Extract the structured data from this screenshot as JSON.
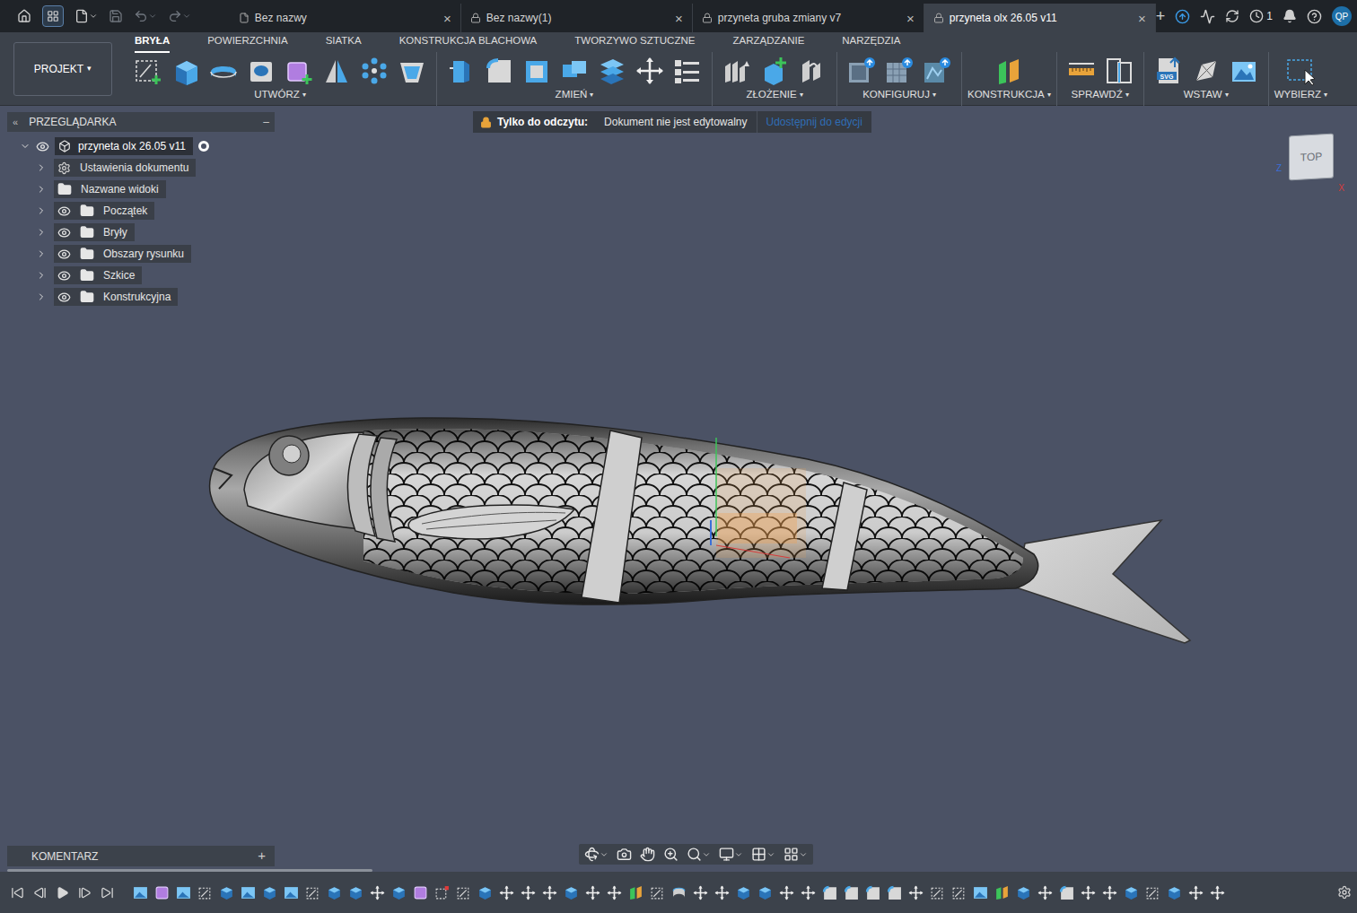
{
  "app_bar": {
    "user_initials": "QP",
    "jobs_count": "1",
    "new_tab": "+",
    "close_glyph": "×"
  },
  "document_tabs": [
    {
      "label": "Bez nazwy",
      "selected": false,
      "locked": false
    },
    {
      "label": "Bez nazwy(1)",
      "selected": false,
      "locked": true
    },
    {
      "label": "przyneta gruba zmiany v7",
      "selected": false,
      "locked": true
    },
    {
      "label": "przyneta olx 26.05 v11",
      "selected": true,
      "locked": true
    }
  ],
  "workspace": {
    "label": "PROJEKT",
    "caret": "▾"
  },
  "ribbon_tabs": [
    {
      "label": "BRYŁA",
      "selected": true
    },
    {
      "label": "POWIERZCHNIA",
      "selected": false
    },
    {
      "label": "SIATKA",
      "selected": false
    },
    {
      "label": "KONSTRUKCJA BLACHOWA",
      "selected": false
    },
    {
      "label": "TWORZYWO SZTUCZNE",
      "selected": false
    },
    {
      "label": "ZARZĄDZANIE",
      "selected": false
    },
    {
      "label": "NARZĘDZIA",
      "selected": false
    }
  ],
  "tool_groups": [
    {
      "label": "UTWÓRZ",
      "caret": "▾",
      "tools": [
        {
          "kind": "sketch",
          "badge": ""
        },
        {
          "kind": "extrude",
          "badge": ""
        },
        {
          "kind": "revolve",
          "badge": ""
        },
        {
          "kind": "hole",
          "badge": ""
        },
        {
          "kind": "form",
          "badge": ""
        },
        {
          "kind": "mirror",
          "badge": ""
        },
        {
          "kind": "pattern",
          "badge": ""
        },
        {
          "kind": "boundary",
          "badge": ""
        }
      ]
    },
    {
      "label": "ZMIEŃ",
      "caret": "▾",
      "tools": [
        {
          "kind": "presspull",
          "badge": ""
        },
        {
          "kind": "fillet",
          "badge": ""
        },
        {
          "kind": "shell",
          "badge": ""
        },
        {
          "kind": "combine",
          "badge": ""
        },
        {
          "kind": "offset",
          "badge": ""
        },
        {
          "kind": "move",
          "badge": ""
        },
        {
          "kind": "parameters",
          "badge": ""
        }
      ]
    },
    {
      "label": "ZŁOŻENIE",
      "caret": "▾",
      "tools": [
        {
          "kind": "joints",
          "badge": ""
        },
        {
          "kind": "component",
          "badge": ""
        },
        {
          "kind": "joint",
          "badge": ""
        }
      ]
    },
    {
      "label": "KONFIGURUJ",
      "caret": "▾",
      "tools": [
        {
          "kind": "configure",
          "badge": ""
        },
        {
          "kind": "table",
          "badge": ""
        },
        {
          "kind": "theme",
          "badge": ""
        }
      ]
    },
    {
      "label": "KONSTRUKCJA",
      "caret": "▾",
      "tools": [
        {
          "kind": "plane",
          "badge": ""
        }
      ]
    },
    {
      "label": "SPRAWDŹ",
      "caret": "▾",
      "tools": [
        {
          "kind": "measure",
          "badge": ""
        },
        {
          "kind": "interference",
          "badge": ""
        }
      ]
    },
    {
      "label": "WSTAW",
      "caret": "▾",
      "tools": [
        {
          "kind": "svg",
          "badge": "SVG"
        },
        {
          "kind": "mesh",
          "badge": ""
        },
        {
          "kind": "canvas",
          "badge": ""
        }
      ]
    },
    {
      "label": "WYBIERZ",
      "caret": "▾",
      "tools": [
        {
          "kind": "select",
          "badge": ""
        }
      ]
    }
  ],
  "browser": {
    "title": "PRZEGLĄDARKA",
    "collapse_glyph": "«",
    "minimize_glyph": "–",
    "root": {
      "label": "przyneta olx 26.05 v11",
      "expanded": true,
      "visible": true
    },
    "items": [
      {
        "label": "Ustawienia dokumentu",
        "kind": "settings",
        "expanded": false
      },
      {
        "label": "Nazwane widoki",
        "kind": "folder",
        "expanded": false
      },
      {
        "label": "Początek",
        "kind": "layer",
        "expanded": false
      },
      {
        "label": "Bryły",
        "kind": "layer",
        "expanded": false
      },
      {
        "label": "Obszary rysunku",
        "kind": "layer",
        "expanded": false
      },
      {
        "label": "Szkice",
        "kind": "layer",
        "expanded": false
      },
      {
        "label": "Konstrukcyjna",
        "kind": "layer",
        "expanded": false
      }
    ]
  },
  "banner": {
    "label": "Tylko do odczytu:",
    "message": "Dokument nie jest edytowalny",
    "action": "Udostępnij do edycji"
  },
  "view_cube": {
    "face": "TOP",
    "axes": [
      {
        "label": "Z",
        "color": "#3b6fd8"
      },
      {
        "label": "X",
        "color": "#d83b3b"
      }
    ]
  },
  "comments": {
    "title": "KOMENTARZ",
    "add": "+"
  },
  "nav_tools": [
    "orbit",
    "look",
    "pan",
    "zoom-window",
    "zoom",
    "display",
    "grid",
    "viewports"
  ],
  "timeline": {
    "controls": [
      "first",
      "prev",
      "play",
      "next",
      "last"
    ],
    "features": [
      "canvas",
      "form",
      "canvas",
      "sketch",
      "extrude",
      "canvas",
      "extrude",
      "canvas",
      "sketch",
      "extrude",
      "extrude",
      "move",
      "extrude",
      "form",
      "sketch-error",
      "sketch",
      "extrude",
      "move",
      "move",
      "move",
      "extrude",
      "move",
      "move",
      "plane",
      "sketch",
      "loft",
      "move",
      "move",
      "extrude",
      "extrude",
      "move",
      "move",
      "fillet",
      "fillet",
      "fillet",
      "fillet",
      "move",
      "sketch",
      "sketch",
      "canvas",
      "plane",
      "extrude",
      "move",
      "fillet",
      "move",
      "move",
      "extrude",
      "sketch",
      "extrude",
      "move",
      "move"
    ]
  }
}
